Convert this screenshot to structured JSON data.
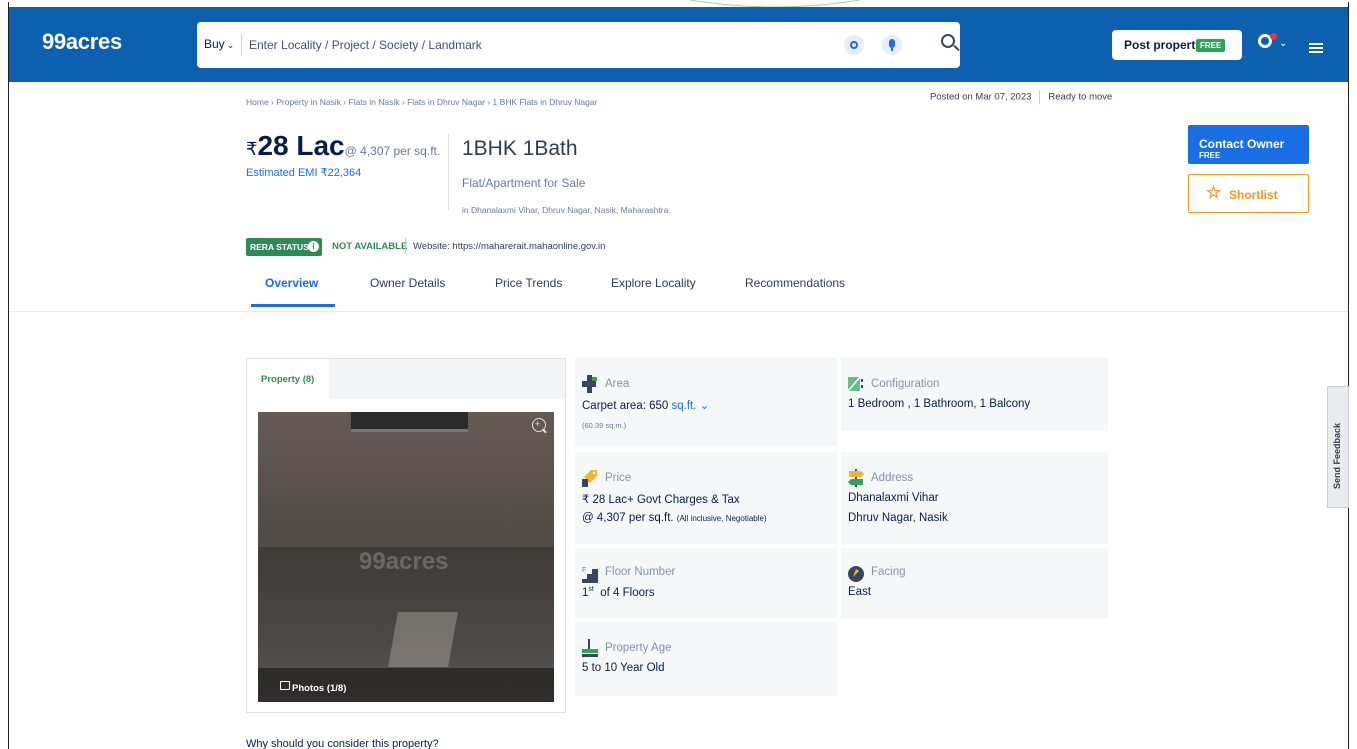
{
  "colors": {
    "brand_blue": "#0d5fb0",
    "link_blue": "#1a6ee3",
    "rera_green": "#2e8b57",
    "shortlist_orange": "#f49623",
    "free_green": "#2ea35a"
  },
  "header": {
    "logo": "99acres",
    "buy_label": "Buy",
    "search_placeholder": "Enter Locality / Project / Society / Landmark",
    "post_property_label": "Post property",
    "free_tag": "FREE",
    "icons": [
      "location-icon",
      "mic-icon",
      "search-icon",
      "user-icon",
      "menu-icon"
    ]
  },
  "breadcrumb": "Home › Property in Nasik › Flats in Nasik › Flats in Dhruv Nagar › 1 BHK Flats in Dhruv Nagar",
  "posted": {
    "date": "Posted on Mar 07, 2023",
    "status": "Ready to move"
  },
  "listing": {
    "currency": "₹",
    "price": "28 Lac",
    "per_sqft": "@ 4,307 per sq.ft.",
    "emi": "Estimated EMI ₹22,364",
    "bhk": "1BHK 1Bath",
    "type": "Flat/Apartment for Sale",
    "location": "in Dhanalaxmi Vihar, Dhruv Nagar, Nasik, Maharashtra"
  },
  "rera": {
    "badge": "RERA STATUS",
    "status": "NOT AVAILABLE",
    "website": "Website: https://maharerait.mahaonline.gov.in"
  },
  "actions": {
    "contact_label": "Contact Owner",
    "contact_free": "FREE",
    "shortlist_label": "Shortlist"
  },
  "tabs": [
    "Overview",
    "Owner Details",
    "Price Trends",
    "Explore Locality",
    "Recommendations"
  ],
  "gallery": {
    "tab_label": "Property (8)",
    "watermark": "99acres",
    "photos_label": "Photos (1/8)"
  },
  "details": {
    "area": {
      "label": "Area",
      "value": "Carpet area: 650",
      "unit": "sq.ft.",
      "sub": "(60.39 sq.m.)"
    },
    "configuration": {
      "label": "Configuration",
      "value": "1 Bedroom , 1 Bathroom, 1 Balcony"
    },
    "price": {
      "label": "Price",
      "line1": "₹ 28 Lac+ Govt Charges & Tax",
      "line2": "@ 4,307 per sq.ft.",
      "line2_note": "(All inclusive, Negotiable)"
    },
    "address": {
      "label": "Address",
      "line1": "Dhanalaxmi Vihar",
      "line2": "Dhruv Nagar, Nasik"
    },
    "floor": {
      "label": "Floor Number",
      "floor_num": "1",
      "floor_sup": "st",
      "of_floors": "of 4 Floors"
    },
    "facing": {
      "label": "Facing",
      "value": "East"
    },
    "age": {
      "label": "Property Age",
      "value": "5 to 10 Year Old"
    }
  },
  "feedback_label": "Send Feedback",
  "why_heading": "Why should you consider this property?"
}
